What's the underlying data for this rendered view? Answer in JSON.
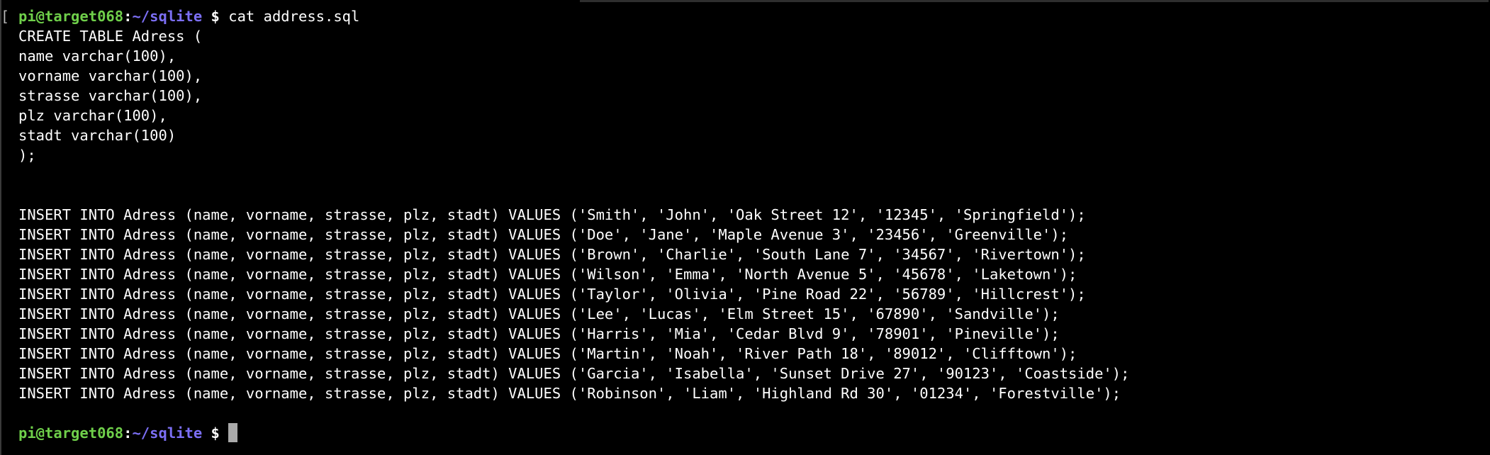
{
  "prompt": {
    "bracket": "[",
    "user_host": "pi@target068",
    "colon": ":",
    "path": "~/sqlite",
    "symbol": "$"
  },
  "command": "cat address.sql",
  "output_lines": [
    "CREATE TABLE Adress (",
    "name varchar(100),",
    "vorname varchar(100),",
    "strasse varchar(100),",
    "plz varchar(100),",
    "stadt varchar(100)",
    ");",
    "",
    "",
    "INSERT INTO Adress (name, vorname, strasse, plz, stadt) VALUES ('Smith', 'John', 'Oak Street 12', '12345', 'Springfield');",
    "INSERT INTO Adress (name, vorname, strasse, plz, stadt) VALUES ('Doe', 'Jane', 'Maple Avenue 3', '23456', 'Greenville');",
    "INSERT INTO Adress (name, vorname, strasse, plz, stadt) VALUES ('Brown', 'Charlie', 'South Lane 7', '34567', 'Rivertown');",
    "INSERT INTO Adress (name, vorname, strasse, plz, stadt) VALUES ('Wilson', 'Emma', 'North Avenue 5', '45678', 'Laketown');",
    "INSERT INTO Adress (name, vorname, strasse, plz, stadt) VALUES ('Taylor', 'Olivia', 'Pine Road 22', '56789', 'Hillcrest');",
    "INSERT INTO Adress (name, vorname, strasse, plz, stadt) VALUES ('Lee', 'Lucas', 'Elm Street 15', '67890', 'Sandville');",
    "INSERT INTO Adress (name, vorname, strasse, plz, stadt) VALUES ('Harris', 'Mia', 'Cedar Blvd 9', '78901', 'Pineville');",
    "INSERT INTO Adress (name, vorname, strasse, plz, stadt) VALUES ('Martin', 'Noah', 'River Path 18', '89012', 'Clifftown');",
    "INSERT INTO Adress (name, vorname, strasse, plz, stadt) VALUES ('Garcia', 'Isabella', 'Sunset Drive 27', '90123', 'Coastside');",
    "INSERT INTO Adress (name, vorname, strasse, plz, stadt) VALUES ('Robinson', 'Liam', 'Highland Rd 30', '01234', 'Forestville');",
    ""
  ],
  "colors": {
    "background": "#000000",
    "text": "#ffffff",
    "prompt_user": "#6fcf4a",
    "prompt_path": "#7c6ff5",
    "cursor": "#a9a9a9"
  }
}
